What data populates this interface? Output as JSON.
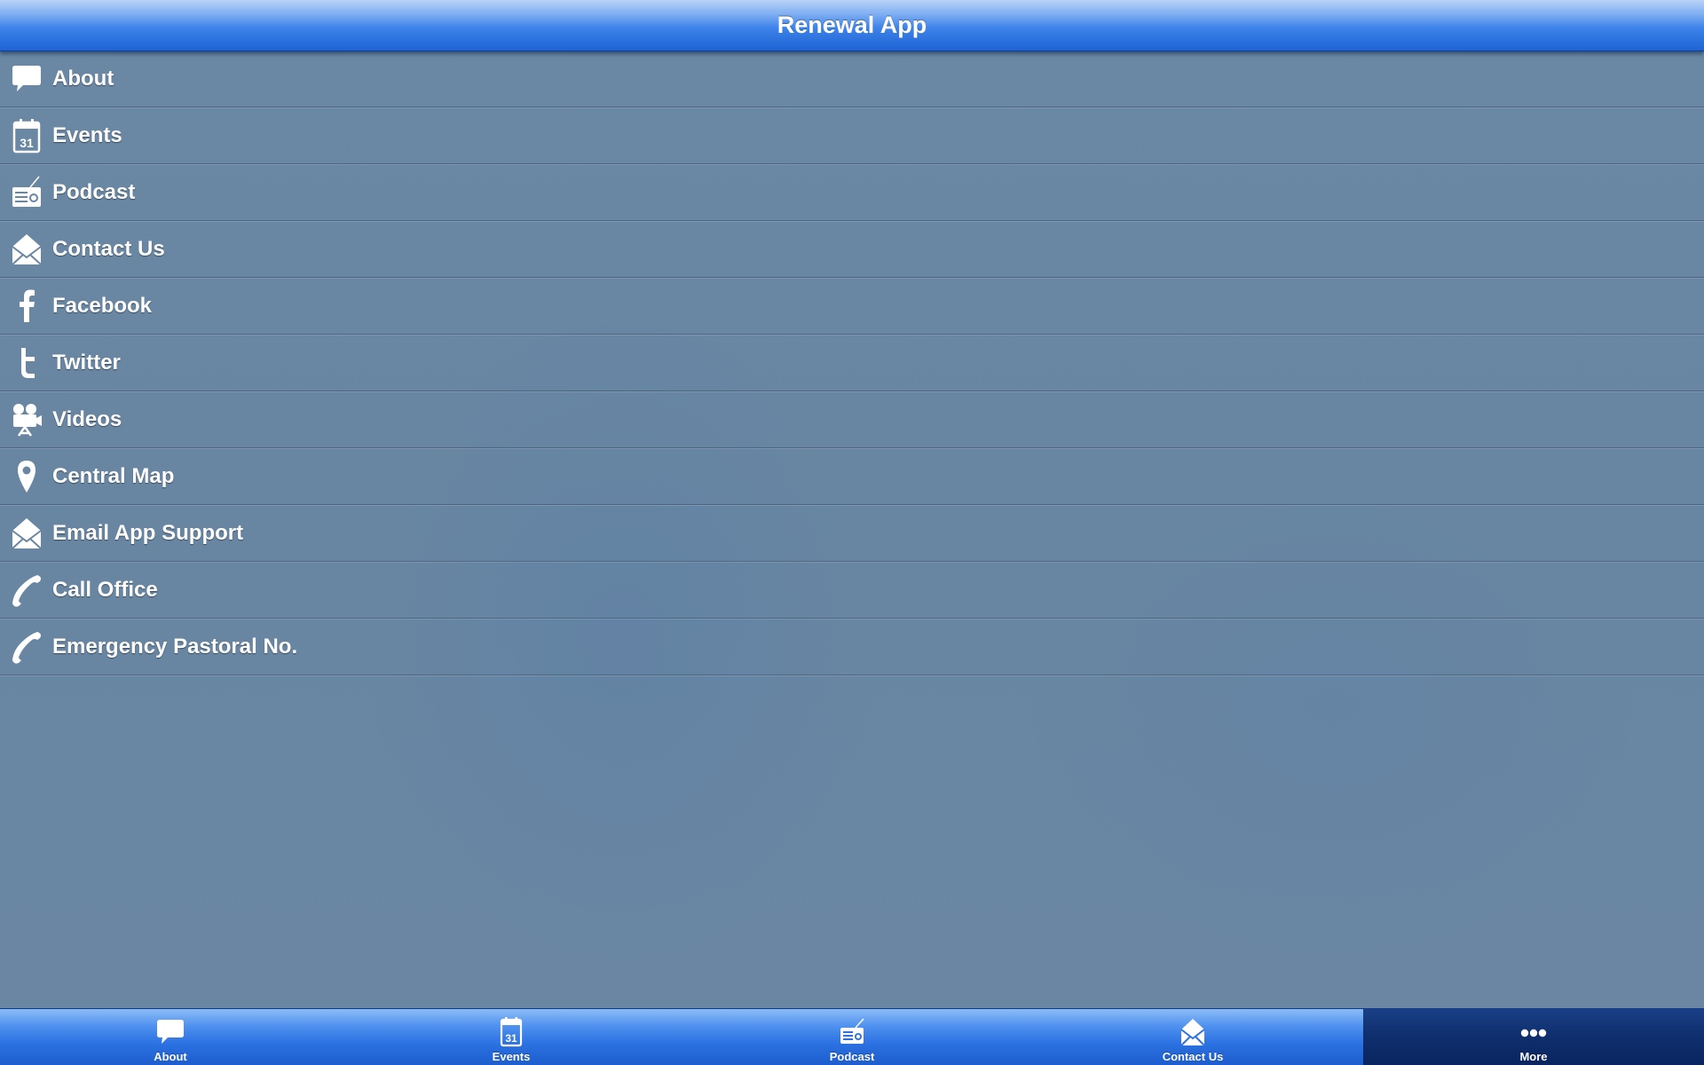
{
  "header": {
    "title": "Renewal App"
  },
  "menu": {
    "items": [
      {
        "label": "About",
        "icon": "speech-bubble-icon"
      },
      {
        "label": "Events",
        "icon": "calendar-icon"
      },
      {
        "label": "Podcast",
        "icon": "radio-icon"
      },
      {
        "label": "Contact Us",
        "icon": "envelope-icon"
      },
      {
        "label": "Facebook",
        "icon": "facebook-icon"
      },
      {
        "label": "Twitter",
        "icon": "twitter-icon"
      },
      {
        "label": "Videos",
        "icon": "video-camera-icon"
      },
      {
        "label": "Central Map",
        "icon": "map-pin-icon"
      },
      {
        "label": "Email App Support",
        "icon": "envelope-icon"
      },
      {
        "label": "Call Office",
        "icon": "phone-icon"
      },
      {
        "label": "Emergency Pastoral No.",
        "icon": "phone-icon"
      }
    ]
  },
  "calendar_day": "31",
  "tabbar": {
    "active": "More",
    "tabs": [
      {
        "label": "About",
        "icon": "speech-bubble-icon"
      },
      {
        "label": "Events",
        "icon": "calendar-icon"
      },
      {
        "label": "Podcast",
        "icon": "radio-icon"
      },
      {
        "label": "Contact Us",
        "icon": "envelope-icon"
      },
      {
        "label": "More",
        "icon": "more-dots-icon"
      }
    ]
  },
  "colors": {
    "header_top": "#b9d3f7",
    "header_bottom": "#1e63d3",
    "list_background": "#6a86a3",
    "tab_active": "#0e2e6c",
    "text": "#ffffff"
  }
}
